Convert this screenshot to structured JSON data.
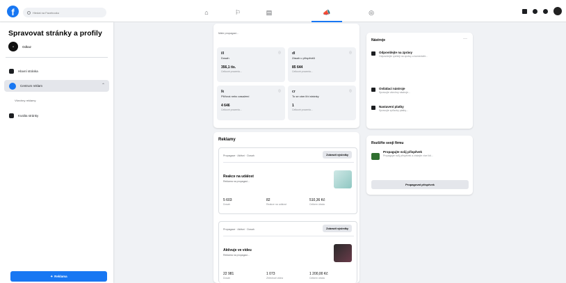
{
  "search": {
    "placeholder": "Hledat na Facebooku"
  },
  "sidebar": {
    "title": "Spravovat stránky a profily",
    "page_name": "Odkaz",
    "items": [
      {
        "label": "Hlavní stránka"
      },
      {
        "label": "Centrum reklam",
        "sub": "Všechny reklamy"
      },
      {
        "label": "Kvalita stránky"
      }
    ],
    "button_label": "Reklama"
  },
  "main": {
    "intro": "Máte propagaci...",
    "stats": [
      {
        "icon": "ill",
        "label": "Dosah",
        "value": "356,1 tis.",
        "sub": "Celkové procento..."
      },
      {
        "icon": "dl",
        "label": "Zásah u příspěvků",
        "value": "85 644",
        "sub": "Celkové procento..."
      },
      {
        "icon": "lk",
        "label": "Pilířová nebo zasažení",
        "value": "4 646",
        "sub": "Celkové procento..."
      },
      {
        "icon": "cr",
        "label": "To se vám líbí stránky",
        "value": "1",
        "sub": "Celkové procento..."
      }
    ],
    "ads_title": "Reklamy",
    "ads": [
      {
        "meta": "Propagace · Aktivní · Dosah",
        "button": "Zobrazit výsledky",
        "title": "Reakce na událost",
        "desc": "Reklama na propagaci...",
        "stats": [
          {
            "value": "5 603",
            "label": "Dosah"
          },
          {
            "value": "82",
            "label": "Reakce na událost"
          },
          {
            "value": "510,36 Kč",
            "label": "Celkem útrata"
          }
        ]
      },
      {
        "meta": "Propagace · Aktivní · Dosah",
        "button": "Zobrazit výsledky",
        "title": "Aktivuje ve videu",
        "desc": "Reklama na propagaci...",
        "stats": [
          {
            "value": "22 981",
            "label": "Dosah"
          },
          {
            "value": "1 073",
            "label": "Zhlédnutí videa"
          },
          {
            "value": "1 200,00 Kč",
            "label": "Celkem útrata"
          }
        ]
      }
    ]
  },
  "tools": {
    "title": "Nástroje",
    "more": "···",
    "items": [
      {
        "title": "Odpovídejte na zprávy",
        "desc": "Odpovídejte rychleji na zprávy a komentáře..."
      },
      {
        "title": "Ovládací nástroje",
        "desc": "Spravujte všechny nástroje..."
      },
      {
        "title": "Nastavení platby",
        "desc": "Spravujte způsoby platby..."
      }
    ]
  },
  "grow": {
    "title": "Rozšiřte svoji firmu",
    "promo_title": "Propagujte svůj příspěvek",
    "promo_desc": "Propagujte svůj příspěvek a získejte více lidí...",
    "button": "Propagovat příspěvek"
  }
}
